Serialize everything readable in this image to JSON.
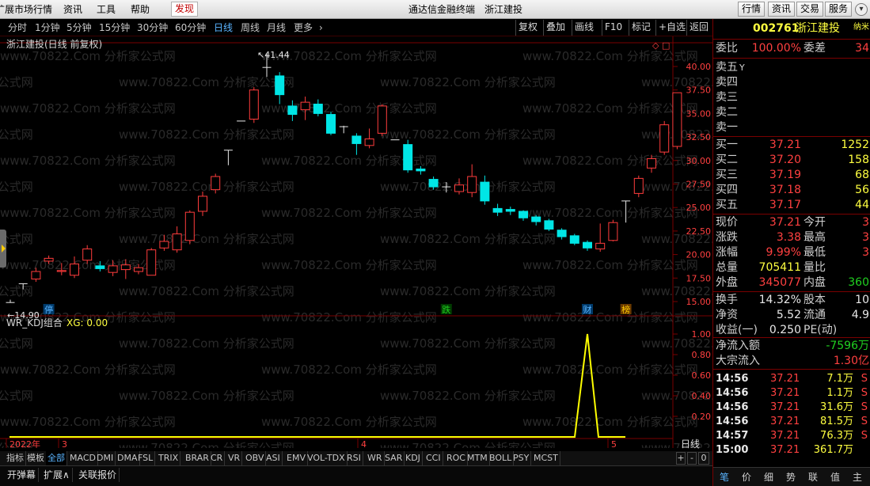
{
  "menubar": {
    "items": [
      {
        "label": "扩展市场行情"
      },
      {
        "label": "资讯"
      },
      {
        "label": "工具"
      },
      {
        "label": "帮助"
      },
      {
        "label": "发现"
      }
    ],
    "title_app": "通达信金融终端",
    "title_stock": "浙江建投",
    "right_buttons": [
      "行情",
      "资讯",
      "交易",
      "服务"
    ]
  },
  "periods": [
    "分时",
    "1分钟",
    "5分钟",
    "15分钟",
    "30分钟",
    "60分钟",
    "日线",
    "周线",
    "月线",
    "更多"
  ],
  "selected_period": "日线",
  "toolbar": [
    "复权",
    "叠加",
    "画线",
    "F10",
    "标记",
    "+自选",
    "返回"
  ],
  "chart": {
    "title": "浙江建投(日线 前复权)",
    "watermark": "www.70822.Com 分析家公式网",
    "price_axis": {
      "min": 15.0,
      "max": 40.0,
      "ticks": [
        "40.00",
        "37.50",
        "35.00",
        "32.50",
        "30.00",
        "27.50",
        "25.00",
        "22.50",
        "20.00",
        "17.50",
        "15.00"
      ]
    },
    "high_label": "41.44",
    "low_label": "14.90",
    "markers": [
      "停",
      "跌",
      "财",
      "榜"
    ],
    "candles": [
      {
        "o": 14.9,
        "c": 14.9,
        "h": 15.2,
        "l": 14.9
      },
      {
        "o": 16.9,
        "c": 16.9,
        "h": 16.9,
        "l": 16.3
      },
      {
        "o": 17.4,
        "c": 18.2,
        "h": 18.6,
        "l": 17.1
      },
      {
        "o": 19.3,
        "c": 19.6,
        "h": 19.9,
        "l": 19.0
      },
      {
        "o": 18.2,
        "c": 18.3,
        "h": 19.1,
        "l": 17.8
      },
      {
        "o": 17.8,
        "c": 19.0,
        "h": 19.8,
        "l": 17.5
      },
      {
        "o": 19.4,
        "c": 20.6,
        "h": 21.0,
        "l": 19.0
      },
      {
        "o": 18.8,
        "c": 18.5,
        "h": 19.3,
        "l": 18.2
      },
      {
        "o": 18.1,
        "c": 18.8,
        "h": 19.4,
        "l": 17.7
      },
      {
        "o": 18.4,
        "c": 18.9,
        "h": 19.5,
        "l": 17.4
      },
      {
        "o": 18.2,
        "c": 18.6,
        "h": 19.0,
        "l": 17.9
      },
      {
        "o": 17.8,
        "c": 20.5,
        "h": 20.7,
        "l": 17.8
      },
      {
        "o": 20.7,
        "c": 21.4,
        "h": 22.1,
        "l": 20.4
      },
      {
        "o": 20.5,
        "c": 22.2,
        "h": 23.0,
        "l": 20.2
      },
      {
        "o": 21.5,
        "c": 24.5,
        "h": 24.7,
        "l": 21.1
      },
      {
        "o": 24.6,
        "c": 26.2,
        "h": 26.7,
        "l": 24.1
      },
      {
        "o": 26.9,
        "c": 28.3,
        "h": 28.6,
        "l": 26.5
      },
      {
        "o": 31.1,
        "c": 31.1,
        "h": 31.1,
        "l": 29.5
      },
      {
        "o": 34.2,
        "c": 34.2,
        "h": 34.2,
        "l": 34.2
      },
      {
        "o": 34.4,
        "c": 37.5,
        "h": 37.8,
        "l": 34.0
      },
      {
        "o": 39.9,
        "c": 39.9,
        "h": 41.44,
        "l": 38.9
      },
      {
        "o": 39.0,
        "c": 37.0,
        "h": 39.4,
        "l": 36.0
      },
      {
        "o": 35.8,
        "c": 34.9,
        "h": 36.4,
        "l": 34.2
      },
      {
        "o": 35.4,
        "c": 36.2,
        "h": 36.8,
        "l": 34.3
      },
      {
        "o": 36.0,
        "c": 35.0,
        "h": 36.5,
        "l": 34.7
      },
      {
        "o": 34.9,
        "c": 32.9,
        "h": 35.2,
        "l": 32.7
      },
      {
        "o": 33.6,
        "c": 33.6,
        "h": 33.7,
        "l": 32.9
      },
      {
        "o": 32.6,
        "c": 31.8,
        "h": 32.9,
        "l": 30.6
      },
      {
        "o": 31.6,
        "c": 32.3,
        "h": 33.4,
        "l": 31.3
      },
      {
        "o": 32.9,
        "c": 35.8,
        "h": 36.0,
        "l": 32.6
      },
      {
        "o": 32.2,
        "c": 32.2,
        "h": 32.2,
        "l": 32.2
      },
      {
        "o": 31.7,
        "c": 29.0,
        "h": 32.2,
        "l": 28.7
      },
      {
        "o": 29.1,
        "c": 28.9,
        "h": 29.4,
        "l": 28.5
      },
      {
        "o": 28.0,
        "c": 27.2,
        "h": 28.3,
        "l": 26.9
      },
      {
        "o": 27.2,
        "c": 27.2,
        "h": 27.7,
        "l": 26.6
      },
      {
        "o": 26.7,
        "c": 27.4,
        "h": 28.1,
        "l": 26.4
      },
      {
        "o": 26.6,
        "c": 28.3,
        "h": 29.6,
        "l": 26.1
      },
      {
        "o": 27.7,
        "c": 25.7,
        "h": 28.4,
        "l": 25.3
      },
      {
        "o": 24.9,
        "c": 24.5,
        "h": 25.4,
        "l": 24.1
      },
      {
        "o": 24.8,
        "c": 24.6,
        "h": 25.1,
        "l": 24.2
      },
      {
        "o": 24.6,
        "c": 23.9,
        "h": 24.7,
        "l": 23.6
      },
      {
        "o": 24.0,
        "c": 23.5,
        "h": 24.2,
        "l": 23.1
      },
      {
        "o": 23.6,
        "c": 22.7,
        "h": 23.8,
        "l": 22.5
      },
      {
        "o": 22.6,
        "c": 21.9,
        "h": 22.8,
        "l": 21.6
      },
      {
        "o": 22.0,
        "c": 21.2,
        "h": 22.2,
        "l": 21.0
      },
      {
        "o": 21.3,
        "c": 20.7,
        "h": 21.5,
        "l": 20.4
      },
      {
        "o": 20.6,
        "c": 21.2,
        "h": 23.3,
        "l": 20.3
      },
      {
        "o": 21.5,
        "c": 23.4,
        "h": 23.7,
        "l": 21.4
      },
      {
        "o": 25.7,
        "c": 25.7,
        "h": 25.7,
        "l": 23.4
      },
      {
        "o": 26.5,
        "c": 28.1,
        "h": 28.4,
        "l": 26.1
      },
      {
        "o": 29.2,
        "c": 30.2,
        "h": 30.6,
        "l": 28.7
      },
      {
        "o": 30.9,
        "c": 33.8,
        "h": 34.2,
        "l": 30.6
      },
      {
        "o": 31.5,
        "c": 37.21,
        "h": 37.21,
        "l": 31.2
      }
    ]
  },
  "indicator": {
    "name": "WR_KDJ组合",
    "xg_label": "XG: 0.00",
    "axis_ticks": [
      "1.00",
      "0.80",
      "0.60",
      "0.40",
      "0.20"
    ],
    "date_labels": [
      "2022年",
      "3",
      "4",
      "5"
    ],
    "signal_index": 45
  },
  "indicator_tabs": [
    "指标",
    "模板",
    "全部",
    "MACD",
    "DMI",
    "DMA",
    "FSL",
    "TRIX",
    "BRAR",
    "CR",
    "VR",
    "OBV",
    "ASI",
    "EMV",
    "VOL-TDX",
    "RSI",
    "WR",
    "SAR",
    "KDJ",
    "CCI",
    "ROC",
    "MTM",
    "BOLL",
    "PSY",
    "MCST"
  ],
  "selected_indicator_tab": "全部",
  "bottom_tabs": [
    "开弹幕",
    "扩展∧",
    "关联报价"
  ],
  "period_right": {
    "label": "日线",
    "plus": "+",
    "minus": "-",
    "zero": "0"
  },
  "quote": {
    "code": "002761",
    "name": "浙江建投",
    "badge": "纳米",
    "weibi_label": "委比",
    "weibi": "100.00%",
    "weicha_label": "委差",
    "weicha": "34",
    "sell": [
      {
        "label": "卖五",
        "flag": "Y"
      },
      {
        "label": "卖四"
      },
      {
        "label": "卖三"
      },
      {
        "label": "卖二"
      },
      {
        "label": "卖一"
      }
    ],
    "buy": [
      {
        "label": "买一",
        "price": "37.21",
        "vol": "1252"
      },
      {
        "label": "买二",
        "price": "37.20",
        "vol": "158"
      },
      {
        "label": "买三",
        "price": "37.19",
        "vol": "68"
      },
      {
        "label": "买四",
        "price": "37.18",
        "vol": "56"
      },
      {
        "label": "买五",
        "price": "37.17",
        "vol": "44"
      }
    ],
    "stats": [
      {
        "l1": "现价",
        "v1": "37.21",
        "c1": "red",
        "l2": "今开",
        "v2": "3",
        "c2": "red"
      },
      {
        "l1": "涨跌",
        "v1": "3.38",
        "c1": "red",
        "l2": "最高",
        "v2": "3",
        "c2": "red"
      },
      {
        "l1": "涨幅",
        "v1": "9.99%",
        "c1": "red",
        "l2": "最低",
        "v2": "3",
        "c2": "red"
      },
      {
        "l1": "总量",
        "v1": "705411",
        "c1": "yellow",
        "l2": "量比",
        "v2": "",
        "c2": "white"
      },
      {
        "l1": "外盘",
        "v1": "345077",
        "c1": "red",
        "l2": "内盘",
        "v2": "360",
        "c2": "green"
      }
    ],
    "fund": [
      {
        "l1": "换手",
        "v1": "14.32%",
        "l2": "股本",
        "v2": "10"
      },
      {
        "l1": "净资",
        "v1": "5.52",
        "l2": "流通",
        "v2": "4.9"
      },
      {
        "l1": "收益(一)",
        "v1": "0.250",
        "l2": "PE(动)",
        "v2": ""
      }
    ],
    "flow": [
      {
        "label": "净流入额",
        "value": "-7596万",
        "color": "green"
      },
      {
        "label": "大宗流入",
        "value": "1.30亿",
        "color": "red"
      }
    ],
    "ticks": [
      {
        "t": "14:56",
        "p": "37.21",
        "v": "7.1万",
        "s": "S"
      },
      {
        "t": "14:56",
        "p": "37.21",
        "v": "1.1万",
        "s": "S"
      },
      {
        "t": "14:56",
        "p": "37.21",
        "v": "31.6万",
        "s": "S"
      },
      {
        "t": "14:56",
        "p": "37.21",
        "v": "81.5万",
        "s": "S"
      },
      {
        "t": "14:57",
        "p": "37.21",
        "v": "76.3万",
        "s": "S"
      },
      {
        "t": "15:00",
        "p": "37.21",
        "v": "361.7万",
        "s": ""
      }
    ],
    "tabs": [
      "笔",
      "价",
      "细",
      "势",
      "联",
      "值",
      "主"
    ]
  }
}
